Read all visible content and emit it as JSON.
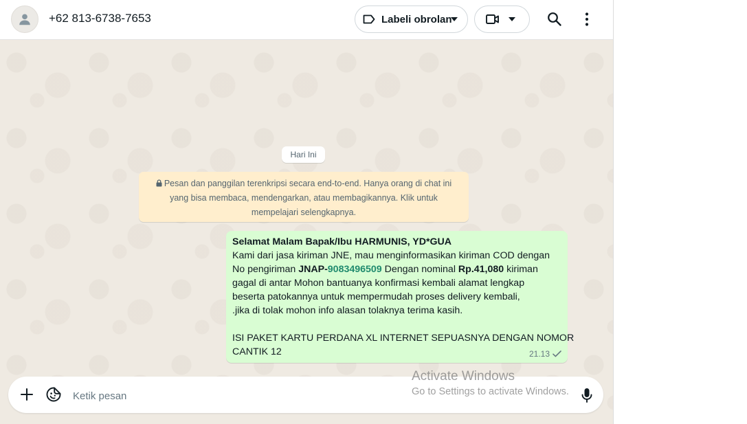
{
  "header": {
    "contact_name": "+62 813-6738-7653",
    "label_button": "Labeli obrolan",
    "icons": [
      "person-icon",
      "label-icon",
      "chevron-down-icon",
      "video-camera-icon",
      "search-icon",
      "more-vertical-icon"
    ]
  },
  "chat": {
    "day_chip": "Hari Ini",
    "encryption_notice": {
      "line1": "Pesan dan panggilan terenkripsi secara end-to-end. Hanya orang di chat ini",
      "line2": "yang bisa membaca, mendengarkan, atau membagikannya. Klik untuk",
      "line3": "mempelajari selengkapnya."
    },
    "message": {
      "title": "Selamat Malam Bapak/Ibu HARMUNIS, YD*GUA",
      "line1": "Kami dari jasa kiriman JNE, mau menginformasikan kiriman COD dengan",
      "line2_prefix": "No pengiriman ",
      "tracking_prefix": "JNAP-",
      "tracking_number": "9083496509",
      "line2_middle": " Dengan nominal ",
      "amount": "Rp.41,080",
      "line2_suffix": " kiriman",
      "line3": "gagal di antar Mohon bantuanya konfirmasi kembali alamat lengkap",
      "line4": "beserta patokannya untuk mempermudah proses delivery kembali,",
      "line5": " .jika di tolak mohon info alasan tolaknya terima kasih.",
      "line6": "ISI PAKET KARTU PERDANA XL INTERNET SEPUASNYA DENGAN NOMOR",
      "line7": "CANTIK 12",
      "time": "21.13",
      "status": "sent"
    }
  },
  "composer": {
    "placeholder": "Ketik pesan"
  },
  "watermark": {
    "title": "Activate Windows",
    "subtitle": "Go to Settings to activate Windows."
  },
  "colors": {
    "outgoing_bubble": "#d9fdd3",
    "notice_bg": "#ffeecd",
    "chat_bg": "#efeae2",
    "link": "#1f8a6e"
  }
}
